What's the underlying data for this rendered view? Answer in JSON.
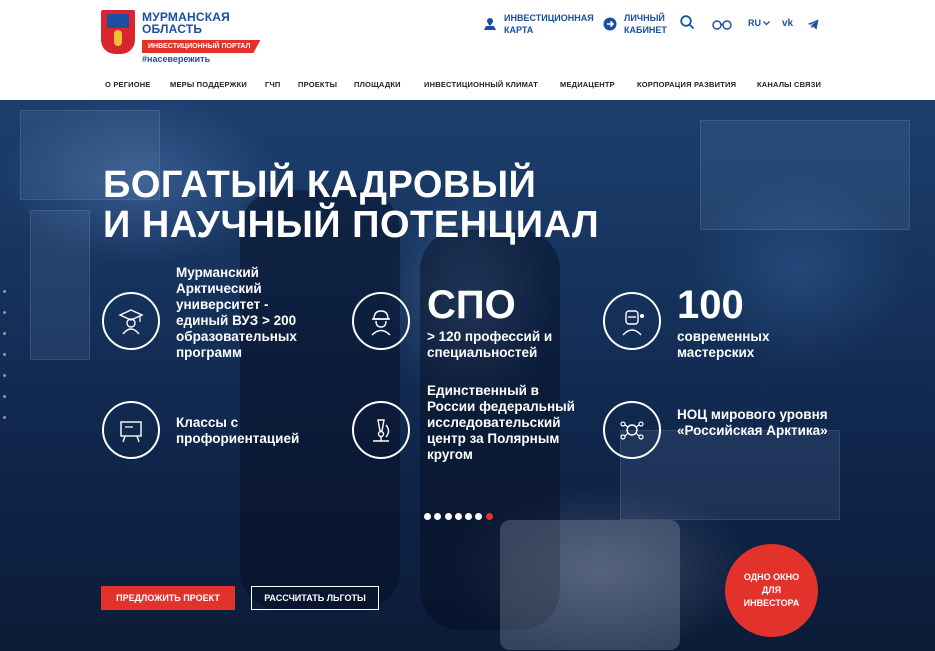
{
  "header": {
    "logo_title": "МУРМАНСКАЯ ОБЛАСТЬ",
    "logo_badge": "ИНВЕСТИЦИОННЫЙ ПОРТАЛ",
    "logo_hashtag": "#насевережить",
    "invest_map": "ИНВЕСТИЦИОННАЯ КАРТА",
    "cabinet": "ЛИЧНЫЙ КАБИНЕТ",
    "lang": "RU",
    "vk": "vk"
  },
  "nav": {
    "items": [
      "О РЕГИОНЕ",
      "МЕРЫ ПОДДЕРЖКИ",
      "ГЧП",
      "ПРОЕКТЫ",
      "ПЛОЩАДКИ",
      "ИНВЕСТИЦИОННЫЙ КЛИМАТ",
      "МЕДИАЦЕНТР",
      "КОРПОРАЦИЯ РАЗВИТИЯ",
      "КАНАЛЫ СВЯЗИ"
    ]
  },
  "hero": {
    "title_line1": "БОГАТЫЙ КАДРОВЫЙ",
    "title_line2": "И НАУЧНЫЙ ПОТЕНЦИАЛ",
    "features": [
      {
        "text": "Мурманский Арктический университет - единый ВУЗ > 200 образовательных программ",
        "icon": "graduate-icon"
      },
      {
        "big": "СПО",
        "text": "> 120 профессий и специальностей",
        "icon": "worker-icon"
      },
      {
        "big": "100",
        "text": "современных мастерских",
        "icon": "welder-icon"
      },
      {
        "text": "Классы с профориентацией",
        "icon": "blackboard-icon"
      },
      {
        "text": "Единственный в России федеральный исследовательский центр за Полярным кругом",
        "icon": "microscope-icon"
      },
      {
        "text": "НОЦ мирового уровня «Российская Арктика»",
        "icon": "research-network-icon"
      }
    ],
    "slides_count": 7,
    "active_slide": 7,
    "propose_button": "ПРЕДЛОЖИТЬ ПРОЕКТ",
    "calc_button": "РАССЧИТАТЬ ЛЬГОТЫ",
    "one_window": "ОДНО ОКНО ДЛЯ ИНВЕСТОРА"
  },
  "colors": {
    "brand_blue": "#1b4fa0",
    "accent_red": "#e3322c"
  }
}
